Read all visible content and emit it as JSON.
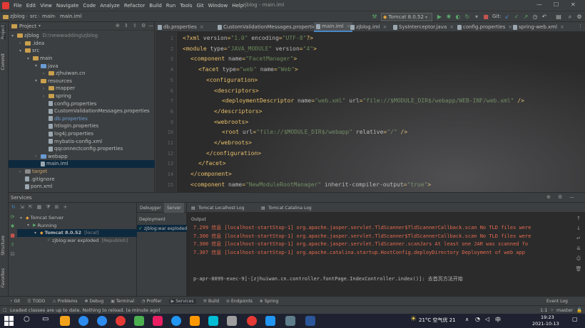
{
  "menu": [
    "File",
    "Edit",
    "View",
    "Navigate",
    "Code",
    "Analyze",
    "Refactor",
    "Build",
    "Run",
    "Tools",
    "Git",
    "Window",
    "Help"
  ],
  "window_title": "zjblog - main.iml",
  "breadcrumb": [
    "zjblog",
    "src",
    "main",
    "main.iml"
  ],
  "run_config": "Tomcat 8.0.52",
  "git_label": "Git:",
  "project": {
    "header": "Project",
    "tree": [
      {
        "label": "zjblog",
        "suffix": "D:\\newwadding\\zjblog",
        "depth": 0,
        "icon": "folder",
        "open": true
      },
      {
        "label": ".idea",
        "depth": 1,
        "icon": "folder",
        "open": false
      },
      {
        "label": "src",
        "depth": 1,
        "icon": "folder",
        "open": true
      },
      {
        "label": "main",
        "depth": 2,
        "icon": "folder",
        "open": true
      },
      {
        "label": "java",
        "depth": 3,
        "icon": "folder-blue",
        "open": true
      },
      {
        "label": "zjhuiwan.cn",
        "depth": 4,
        "icon": "folder",
        "open": false
      },
      {
        "label": "resources",
        "depth": 3,
        "icon": "folder",
        "open": true
      },
      {
        "label": "mapper",
        "depth": 4,
        "icon": "folder",
        "open": false
      },
      {
        "label": "spring",
        "depth": 4,
        "icon": "folder",
        "open": false
      },
      {
        "label": "config.properties",
        "depth": 4,
        "icon": "file"
      },
      {
        "label": "CustomValidationMessages.properties",
        "depth": 4,
        "icon": "file"
      },
      {
        "label": "db.properties",
        "depth": 4,
        "icon": "file"
      },
      {
        "label": "htlogin.properties",
        "depth": 4,
        "icon": "file"
      },
      {
        "label": "log4j.properties",
        "depth": 4,
        "icon": "file"
      },
      {
        "label": "mybatis-config.xml",
        "depth": 4,
        "icon": "file"
      },
      {
        "label": "qqconnectconfig.properties",
        "depth": 4,
        "icon": "file"
      },
      {
        "label": "webapp",
        "depth": 3,
        "icon": "folder-blue",
        "open": false
      },
      {
        "label": "main.iml",
        "depth": 3,
        "icon": "file",
        "selected": true
      },
      {
        "label": "target",
        "depth": 1,
        "icon": "folder-grey",
        "open": false
      },
      {
        "label": ".gitignore",
        "depth": 1,
        "icon": "file"
      },
      {
        "label": "pom.xml",
        "depth": 1,
        "icon": "file"
      }
    ]
  },
  "tabs": [
    {
      "label": "db.properties"
    },
    {
      "label": "CustomValidationMessages.properties"
    },
    {
      "label": "main.iml",
      "active": true
    },
    {
      "label": "zjblog.iml"
    },
    {
      "label": "SysInterceptor.java"
    },
    {
      "label": "config.properties"
    },
    {
      "label": "spring-web.xml"
    }
  ],
  "code_lines": [
    {
      "n": "1",
      "indent": 0,
      "text": "<?xml version=\"1.0\" encoding=\"UTF-8\"?>"
    },
    {
      "n": "2",
      "indent": 0,
      "text": "<module type=\"JAVA_MODULE\" version=\"4\">"
    },
    {
      "n": "3",
      "indent": 1,
      "text": "<component name=\"FacetManager\">"
    },
    {
      "n": "4",
      "indent": 2,
      "text": "<facet type=\"web\" name=\"Web\">"
    },
    {
      "n": "5",
      "indent": 3,
      "text": "<configuration>"
    },
    {
      "n": "6",
      "indent": 4,
      "text": "<descriptors>"
    },
    {
      "n": "7",
      "indent": 5,
      "text": "<deploymentDescriptor name=\"web.xml\" url=\"file://$MODULE_DIR$/webapp/WEB-INF/web.xml\" />"
    },
    {
      "n": "8",
      "indent": 4,
      "text": "</descriptors>"
    },
    {
      "n": "9",
      "indent": 4,
      "text": "<webroots>"
    },
    {
      "n": "10",
      "indent": 5,
      "text": "<root url=\"file://$MODULE_DIR$/webapp\" relative=\"/\" />"
    },
    {
      "n": "11",
      "indent": 4,
      "text": "</webroots>"
    },
    {
      "n": "12",
      "indent": 3,
      "text": "</configuration>"
    },
    {
      "n": "13",
      "indent": 2,
      "text": "</facet>"
    },
    {
      "n": "14",
      "indent": 1,
      "text": "</component>"
    },
    {
      "n": "15",
      "indent": 1,
      "text": "<component name=\"NewModuleRootManager\" inherit-compiler-output=\"true\">"
    },
    {
      "n": "16",
      "indent": 2,
      "text": "<exclude-output />"
    }
  ],
  "services": {
    "header": "Services",
    "tree": [
      {
        "label": "Tomcat Server",
        "depth": 0
      },
      {
        "label": "Running",
        "depth": 1
      },
      {
        "label": "Tomcat 8.0.52",
        "suffix": "[local]",
        "depth": 2,
        "selected": true
      },
      {
        "label": "zjblog:war exploded",
        "suffix": "[Republish]",
        "depth": 3
      }
    ],
    "subtabs": [
      "Debugger",
      "Server",
      "Tomcat Localhost Log",
      "Tomcat Catalina Log"
    ],
    "deployment_label": "Deployment",
    "deployment_item": "zjblog:war exploded",
    "output_label": "Output",
    "log": [
      "7.299 信息 [localhost-startStop-1] org.apache.jasper.servlet.TldScanner$TldScannerCallback.scan No TLD files were",
      "7.300 信息 [localhost-startStop-1] org.apache.jasper.servlet.TldScanner$TldScannerCallback.scan No TLD files were",
      "7.300 信息 [localhost-startStop-1] org.apache.jasper.servlet.TldScanner.scanJars At least one JAR was scanned fo",
      "7.307 信息 [localhost-startStop-1] org.apache.catalina.startup.HostConfig.deployDirectory Deployment of web app"
    ],
    "log_plain": "p-apr-8099-exec-9]-[zjhuiwan.cn.controller.fontPage.IndexController.index()]: 去首页方法开始"
  },
  "bottom_tabs": [
    "Git",
    "TODO",
    "Problems",
    "Debug",
    "Terminal",
    "Profiler",
    "Services",
    "Build",
    "Endpoints",
    "Spring"
  ],
  "bottom_active": "Services",
  "event_log": "Event Log",
  "status_message": "Loaded classes are up to date. Nothing to reload. (a minute ago)",
  "status_right": {
    "pos": "1:1",
    "branch": "master"
  },
  "taskbar": {
    "weather": "21°C 空气优 21",
    "time": "19:23",
    "date": "2021-10-13"
  },
  "left_vertical_tabs": [
    "Project",
    "Commit",
    "Structure",
    "Favorites"
  ],
  "colors": {
    "selection": "#0d293e",
    "tag": "#e8bf6a",
    "string": "#6a8759",
    "error": "#e46b4f"
  }
}
